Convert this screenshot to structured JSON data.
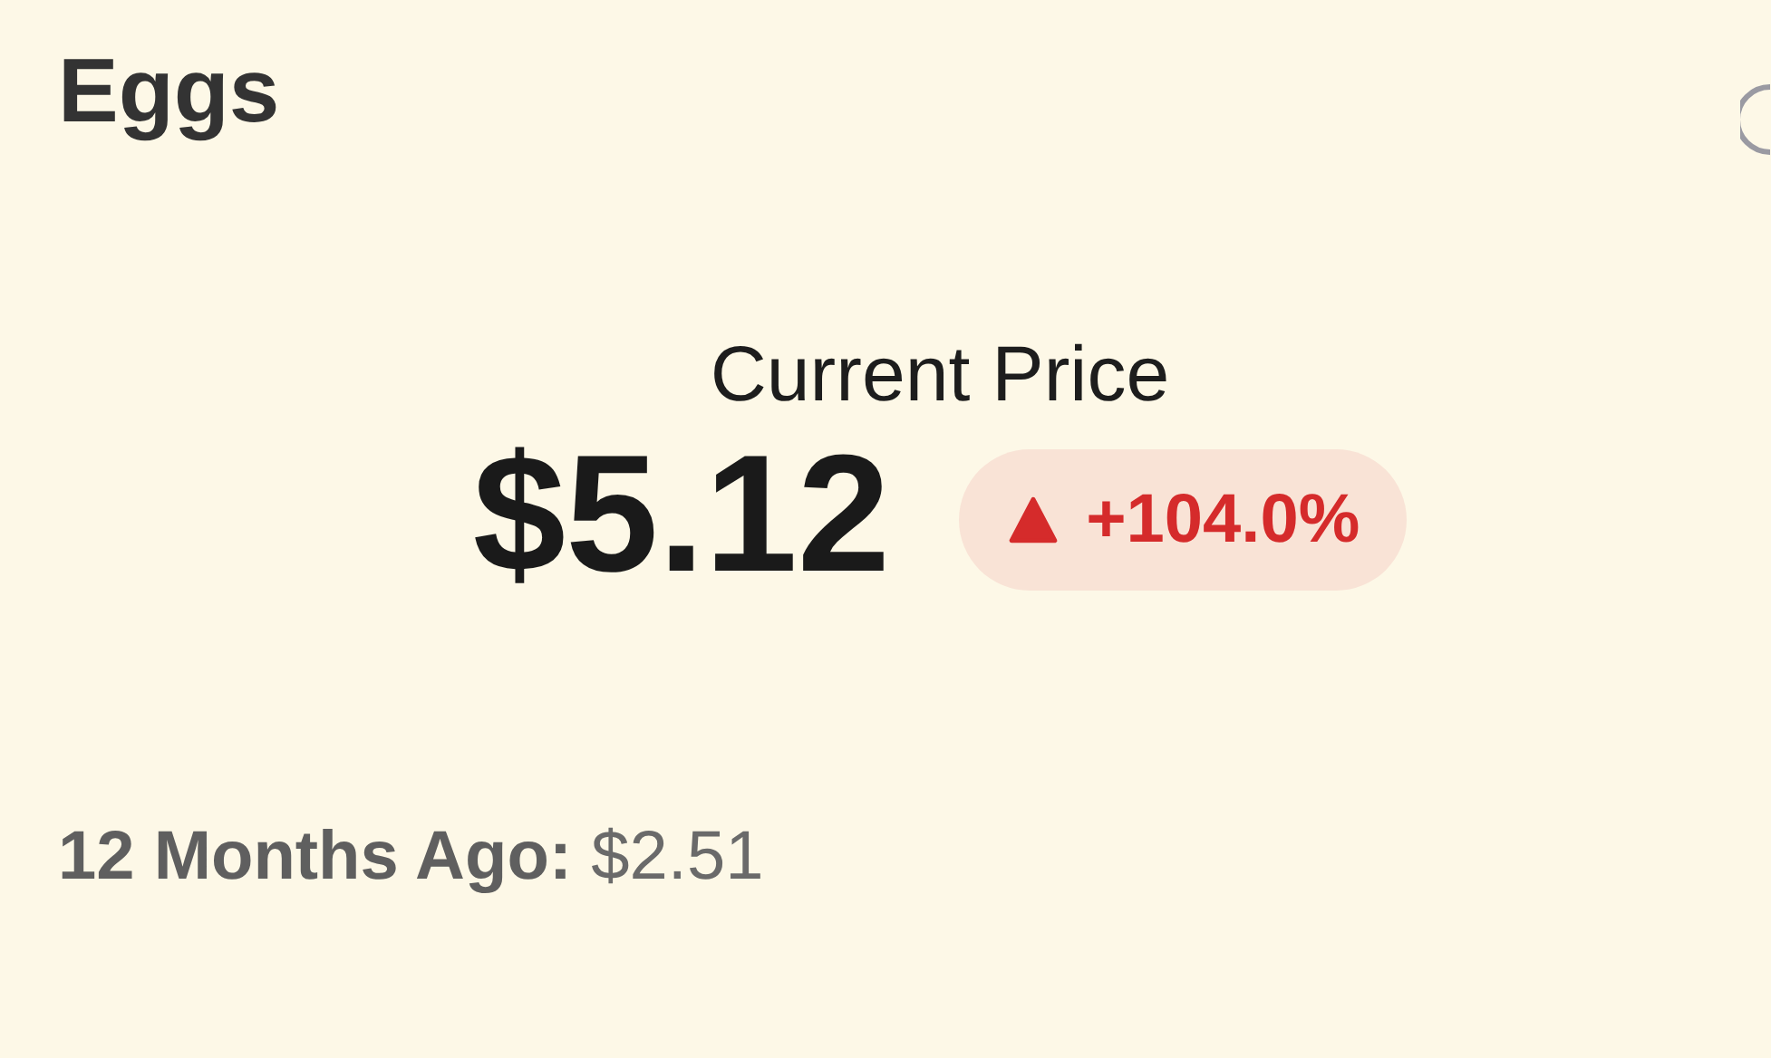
{
  "title": "Eggs",
  "current": {
    "label": "Current Price",
    "price": "$5.12",
    "change": {
      "rising": true,
      "text": "+104.0%"
    }
  },
  "previous": {
    "label": "12 Months Ago:",
    "value": "$2.51"
  }
}
